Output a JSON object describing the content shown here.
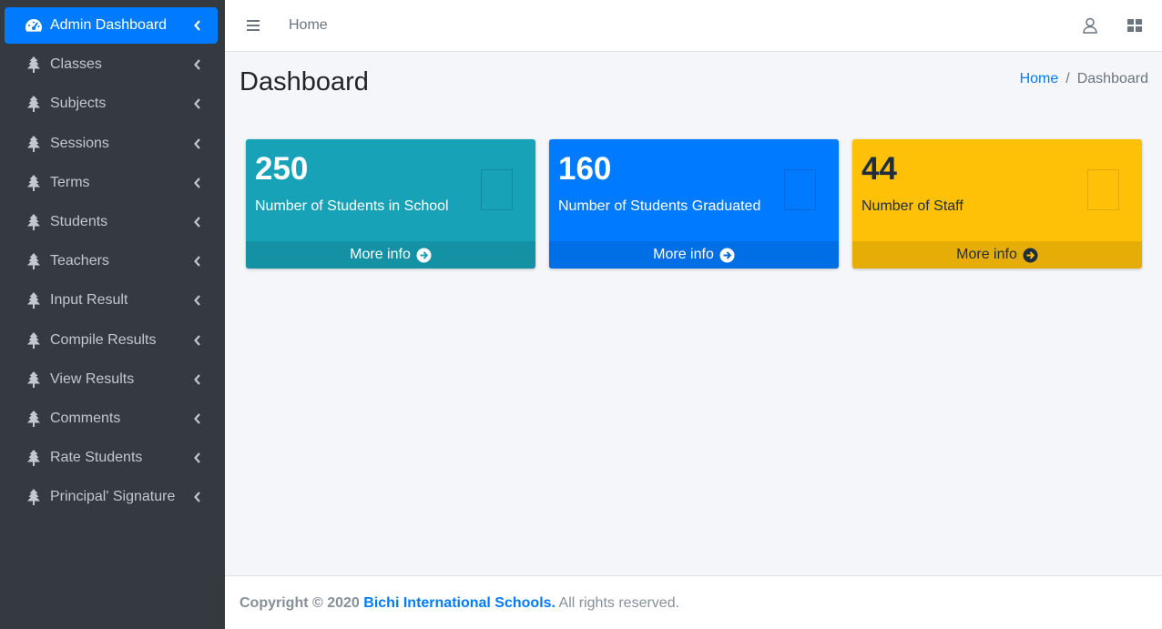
{
  "sidebar": {
    "items": [
      {
        "label": "Admin Dashboard",
        "icon": "tachometer-icon",
        "active": true
      },
      {
        "label": "Classes",
        "icon": "tree-icon"
      },
      {
        "label": "Subjects",
        "icon": "tree-icon"
      },
      {
        "label": "Sessions",
        "icon": "tree-icon"
      },
      {
        "label": "Terms",
        "icon": "tree-icon"
      },
      {
        "label": "Students",
        "icon": "tree-icon"
      },
      {
        "label": "Teachers",
        "icon": "tree-icon"
      },
      {
        "label": "Input Result",
        "icon": "tree-icon"
      },
      {
        "label": "Compile Results",
        "icon": "tree-icon"
      },
      {
        "label": "View Results",
        "icon": "tree-icon"
      },
      {
        "label": "Comments",
        "icon": "tree-icon"
      },
      {
        "label": "Rate Students",
        "icon": "tree-icon"
      },
      {
        "label": "Principal' Signature",
        "icon": "tree-icon"
      }
    ]
  },
  "topbar": {
    "home_label": "Home",
    "icons": [
      "hamburger-icon",
      "user-icon",
      "grid-icon"
    ]
  },
  "content": {
    "title": "Dashboard",
    "breadcrumb": {
      "home": "Home",
      "separator": "/",
      "current": "Dashboard"
    }
  },
  "cards": [
    {
      "number": "250",
      "description": "Number of Students in School",
      "more": "More info",
      "color": "#17a2b8"
    },
    {
      "number": "160",
      "description": "Number of Students Graduated",
      "more": "More info",
      "color": "#007bff"
    },
    {
      "number": "44",
      "description": "Number of Staff",
      "more": "More info",
      "color": "#ffc107"
    }
  ],
  "footer": {
    "copyright": "Copyright © 2020",
    "school": "Bichi International Schools.",
    "rights": "All rights reserved."
  },
  "colors": {
    "sidebar_bg": "#343a40",
    "active": "#007bff",
    "info": "#17a2b8",
    "warning": "#ffc107",
    "page_bg": "#f4f6f9"
  }
}
